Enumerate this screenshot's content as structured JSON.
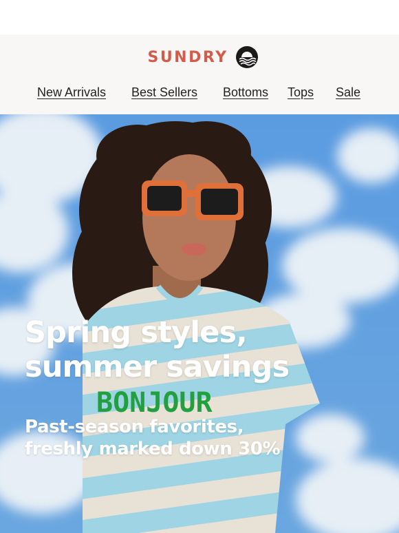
{
  "brand": {
    "name": "SUNDRY",
    "color": "#d65a4a",
    "logo_icon": "sunset-waves-icon"
  },
  "nav": {
    "items": [
      {
        "label": "New Arrivals"
      },
      {
        "label": "Best Sellers"
      },
      {
        "label": "Bottoms"
      },
      {
        "label": "Tops"
      },
      {
        "label": "Sale"
      }
    ]
  },
  "hero": {
    "headline_line1": "Spring styles,",
    "headline_line2": "summer savings",
    "subhead_line1": "Past-season favorites,",
    "subhead_line2": "freshly marked down 30%",
    "shirt_text": "BONJOUR",
    "sky_color": "#5d9ad8",
    "text_color": "#ffffff"
  }
}
